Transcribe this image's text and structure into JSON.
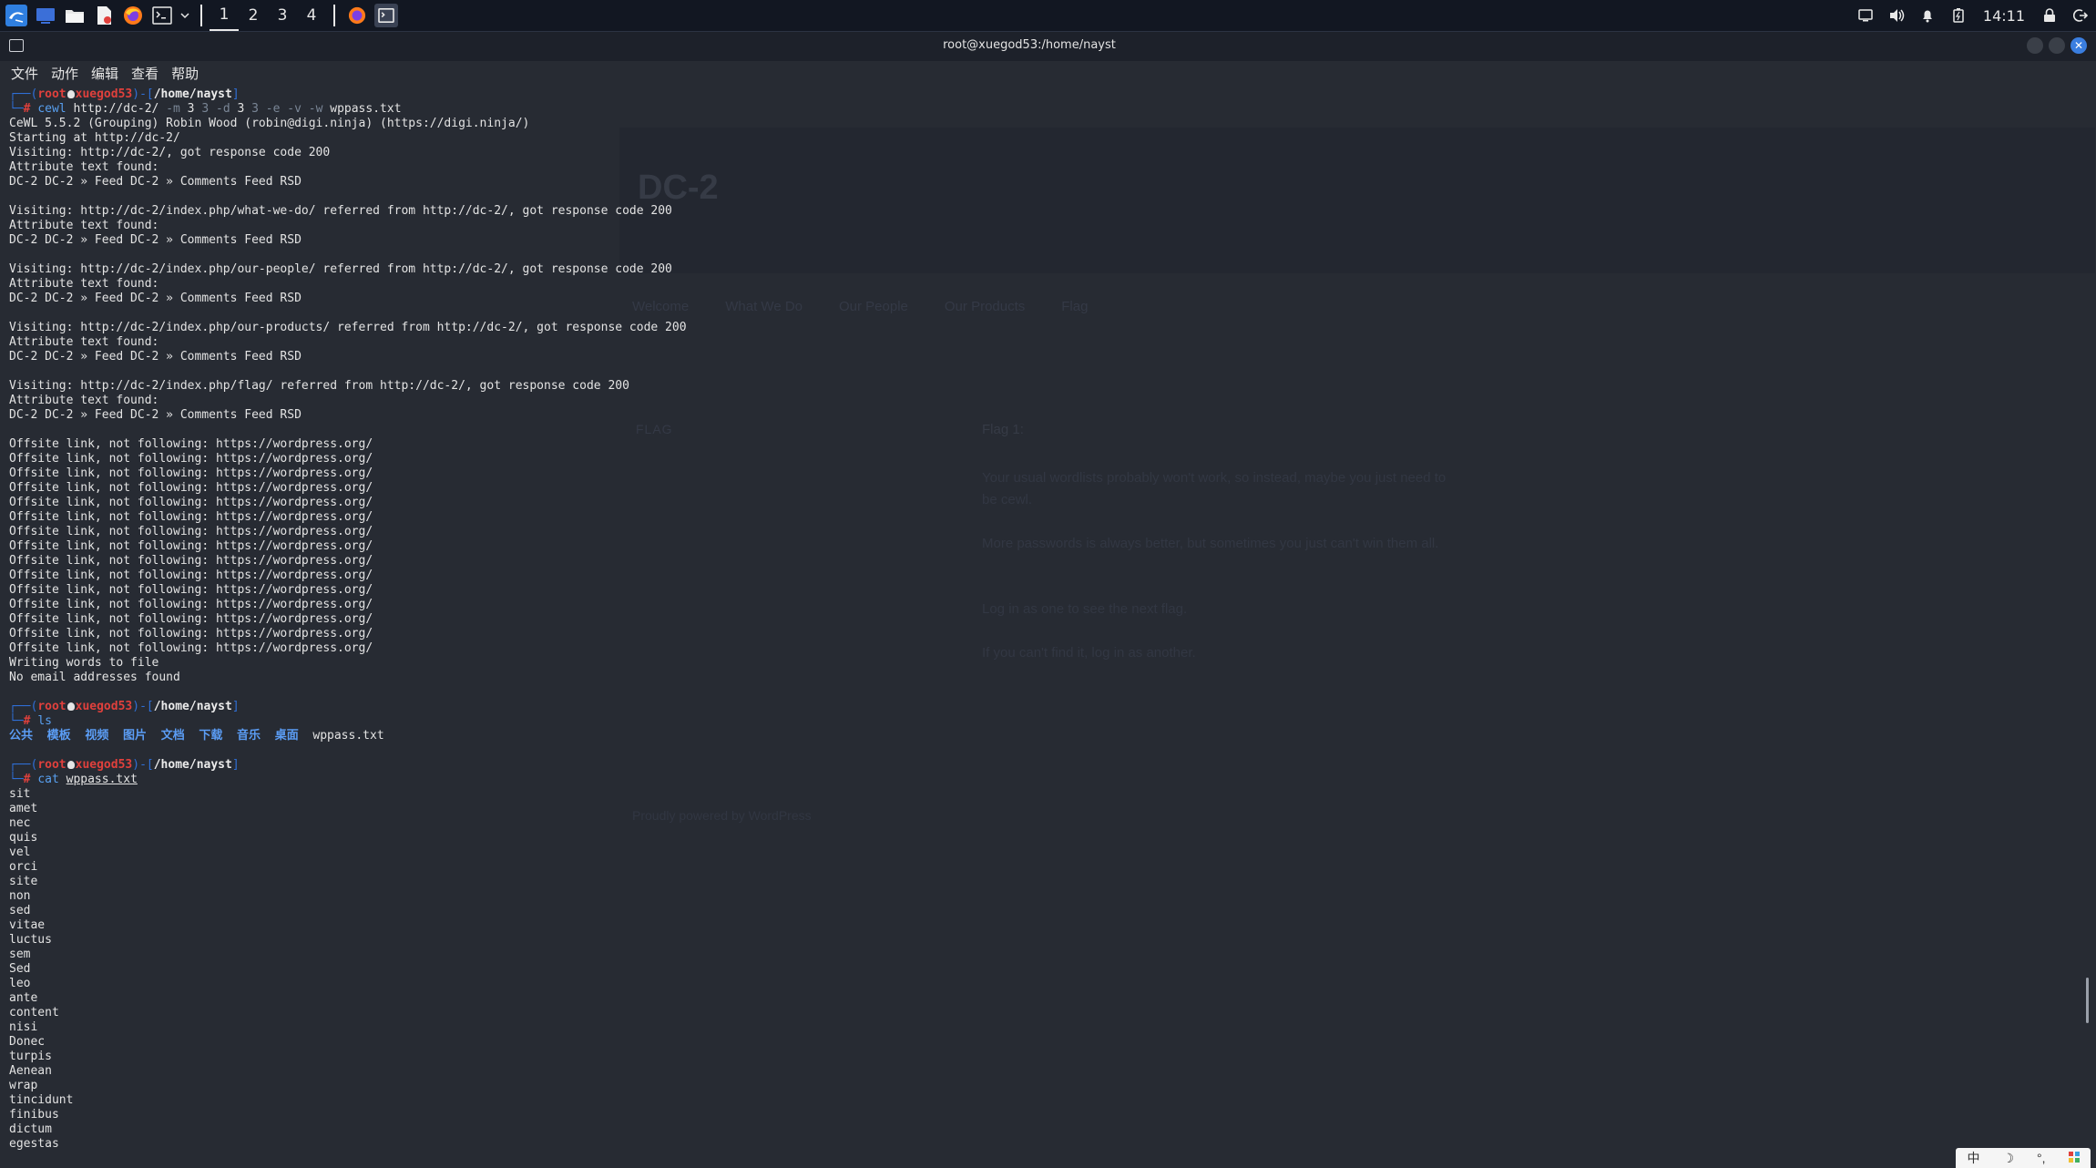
{
  "panel": {
    "workspaces": [
      "1",
      "2",
      "3",
      "4"
    ],
    "active_workspace": 0,
    "clock": "14:11"
  },
  "window": {
    "title": "root@xuegod53:/home/nayst",
    "menu": [
      "文件",
      "动作",
      "编辑",
      "查看",
      "帮助"
    ]
  },
  "background_page": {
    "brand": "DC-2",
    "nav": [
      "Welcome",
      "What We Do",
      "Our People",
      "Our Products",
      "Flag"
    ],
    "section_header": "FLAG",
    "post_title": "Flag 1:",
    "paragraphs": [
      "Your usual wordlists probably won't work, so instead, maybe you just need to be cewl.",
      "More passwords is always better, but sometimes you just can't win them all.",
      "Log in as one to see the next flag.",
      "If you can't find it, log in as another."
    ],
    "footer": "Proudly powered by WordPress"
  },
  "prompt": {
    "user": "root",
    "host": "xuegod53",
    "path": "/home/nayst"
  },
  "blocks": [
    {
      "command": {
        "name": "cewl",
        "pre": " http://dc-2/ ",
        "args": [
          "-m",
          "3",
          "-d",
          "3",
          "-e",
          "-v",
          "-w"
        ],
        "tail": " wppass.txt"
      },
      "output": [
        "CeWL 5.5.2 (Grouping) Robin Wood (robin@digi.ninja) (https://digi.ninja/)",
        "Starting at http://dc-2/",
        "Visiting: http://dc-2/, got response code 200",
        "Attribute text found:",
        "DC-2 DC-2 » Feed DC-2 » Comments Feed RSD",
        "",
        "Visiting: http://dc-2/index.php/what-we-do/ referred from http://dc-2/, got response code 200",
        "Attribute text found:",
        "DC-2 DC-2 » Feed DC-2 » Comments Feed RSD",
        "",
        "Visiting: http://dc-2/index.php/our-people/ referred from http://dc-2/, got response code 200",
        "Attribute text found:",
        "DC-2 DC-2 » Feed DC-2 » Comments Feed RSD",
        "",
        "Visiting: http://dc-2/index.php/our-products/ referred from http://dc-2/, got response code 200",
        "Attribute text found:",
        "DC-2 DC-2 » Feed DC-2 » Comments Feed RSD",
        "",
        "Visiting: http://dc-2/index.php/flag/ referred from http://dc-2/, got response code 200",
        "Attribute text found:",
        "DC-2 DC-2 » Feed DC-2 » Comments Feed RSD",
        "",
        "Offsite link, not following: https://wordpress.org/",
        "Offsite link, not following: https://wordpress.org/",
        "Offsite link, not following: https://wordpress.org/",
        "Offsite link, not following: https://wordpress.org/",
        "Offsite link, not following: https://wordpress.org/",
        "Offsite link, not following: https://wordpress.org/",
        "Offsite link, not following: https://wordpress.org/",
        "Offsite link, not following: https://wordpress.org/",
        "Offsite link, not following: https://wordpress.org/",
        "Offsite link, not following: https://wordpress.org/",
        "Offsite link, not following: https://wordpress.org/",
        "Offsite link, not following: https://wordpress.org/",
        "Offsite link, not following: https://wordpress.org/",
        "Offsite link, not following: https://wordpress.org/",
        "Offsite link, not following: https://wordpress.org/",
        "Writing words to file",
        "No email addresses found",
        ""
      ]
    },
    {
      "command": {
        "name": "ls",
        "pre": "",
        "args": [],
        "tail": ""
      },
      "ls_dirs": [
        "公共",
        "模板",
        "视频",
        "图片",
        "文档",
        "下载",
        "音乐",
        "桌面"
      ],
      "ls_file": "wppass.txt",
      "output": [
        ""
      ]
    },
    {
      "command": {
        "name": "cat",
        "pre": " ",
        "args": [],
        "tail": "",
        "file": "wppass.txt"
      },
      "output": [
        "sit",
        "amet",
        "nec",
        "quis",
        "vel",
        "orci",
        "site",
        "non",
        "sed",
        "vitae",
        "luctus",
        "sem",
        "Sed",
        "leo",
        "ante",
        "content",
        "nisi",
        "Donec",
        "turpis",
        "Aenean",
        "wrap",
        "tincidunt",
        "finibus",
        "dictum",
        "egestas"
      ]
    }
  ],
  "ime": {
    "lang": "中"
  }
}
